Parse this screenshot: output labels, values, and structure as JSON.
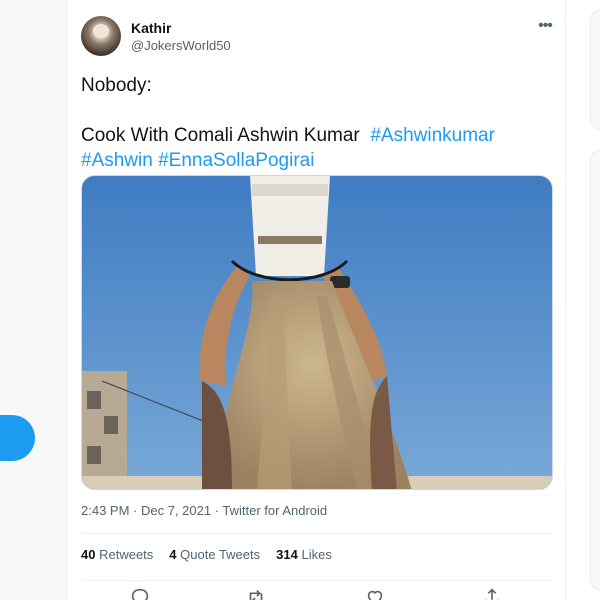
{
  "tweet": {
    "author": {
      "display_name": "Kathir",
      "handle": "@JokersWorld50"
    },
    "text": {
      "line1": "Nobody:",
      "line2_plain": "Cook With Comali Ashwin Kumar",
      "hashtags": [
        "#Ashwinkumar",
        "#Ashwin",
        "#EnnaSollaPogirai"
      ]
    },
    "meta": "2:43 PM · Dec 7, 2021 · Twitter for Android",
    "stats": {
      "retweets": {
        "count": "40",
        "label": "Retweets"
      },
      "quotes": {
        "count": "4",
        "label": "Quote Tweets"
      },
      "likes": {
        "count": "314",
        "label": "Likes"
      }
    }
  },
  "actions": [
    "reply-icon",
    "retweet-icon",
    "like-icon",
    "share-icon"
  ],
  "colors": {
    "accent": "#1d9bf0",
    "text": "#0f1419",
    "secondary": "#536471"
  }
}
